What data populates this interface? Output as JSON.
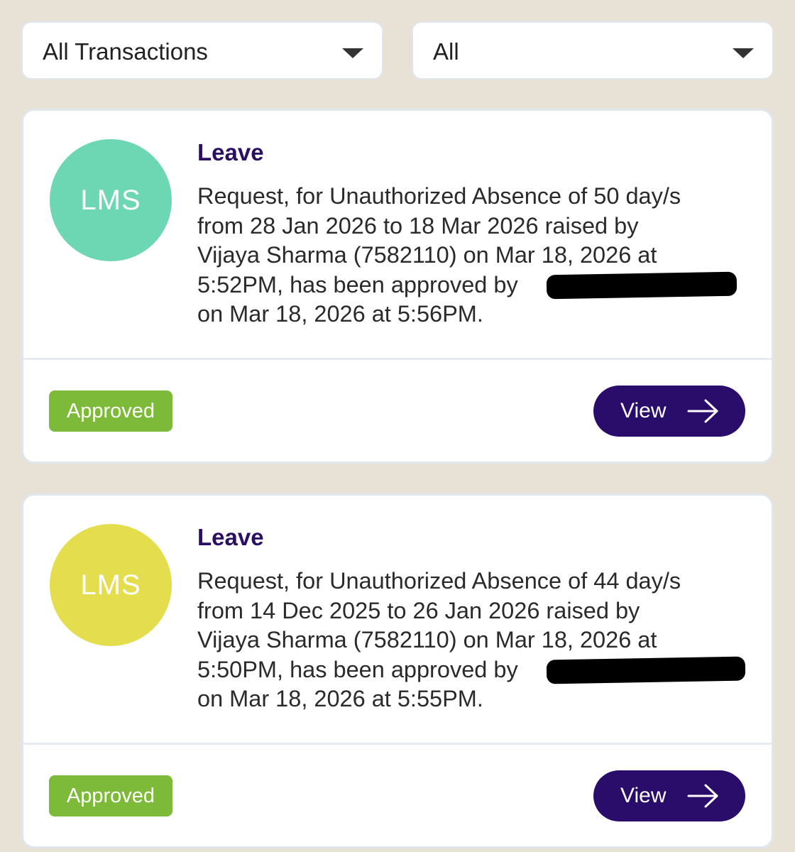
{
  "filters": {
    "transaction_type": "All Transactions",
    "status": "All"
  },
  "colors": {
    "page_bg": "#e8e2d6",
    "avatar_1": "#6dd6b3",
    "avatar_2": "#e4de4e",
    "category_text": "#2a0f63",
    "approved_badge": "#7dba3a",
    "view_button": "#2a0c6b"
  },
  "transactions": [
    {
      "avatar_text": "LMS",
      "category": "Leave",
      "message_line1": "Request, for Unauthorized Absence of 50 day/s",
      "message_line2": "from 28 Jan 2026 to 18 Mar 2026 raised by",
      "message_line3": "Vijaya Sharma (7582110) on Mar 18, 2026 at",
      "message_line4": "5:52PM, has been approved by ",
      "message_line5": "on Mar 18, 2026 at 5:56PM.",
      "status": "Approved",
      "action": "View",
      "action_icon": "arrow-right-icon"
    },
    {
      "avatar_text": "LMS",
      "category": "Leave",
      "message_line1": "Request, for Unauthorized Absence of 44 day/s",
      "message_line2": "from 14 Dec 2025 to 26 Jan 2026 raised by",
      "message_line3": "Vijaya Sharma (7582110) on Mar 18, 2026 at",
      "message_line4": "5:50PM, has been approved by ",
      "message_line5": "on Mar 18, 2026 at 5:55PM.",
      "status": "Approved",
      "action": "View",
      "action_icon": "arrow-right-icon"
    }
  ]
}
